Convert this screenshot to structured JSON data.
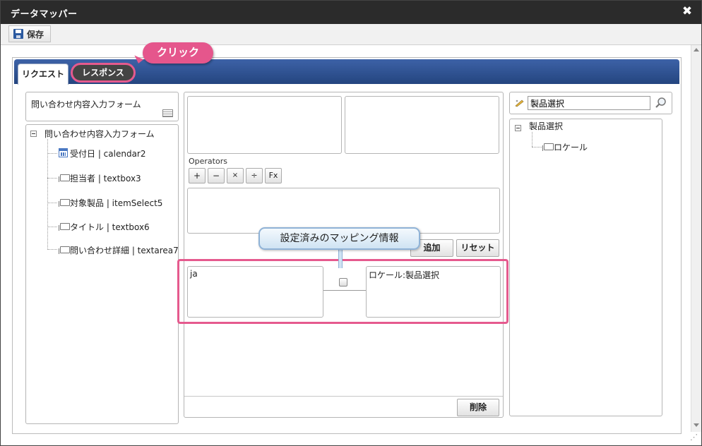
{
  "window": {
    "title": "データマッパー",
    "close_glyph": "✖"
  },
  "toolbar": {
    "save_label": "保存"
  },
  "tabs": [
    {
      "label": "リクエスト"
    },
    {
      "label": "レスポンス"
    }
  ],
  "annotations": {
    "click_label": "クリック",
    "mapping_info_label": "設定済みのマッピング情報",
    "highlight_color": "#e55a8e"
  },
  "left_panel": {
    "form_title": "問い合わせ内容入力フォーム",
    "tree_root": "問い合わせ内容入力フォーム",
    "items": [
      {
        "label": "受付日 | calendar2",
        "icon": "calendar-icon"
      },
      {
        "label": "担当者 | textbox3",
        "icon": "field-icon"
      },
      {
        "label": "対象製品 | itemSelect5",
        "icon": "field-icon"
      },
      {
        "label": "タイトル | textbox6",
        "icon": "field-icon"
      },
      {
        "label": "問い合わせ詳細 | textarea7",
        "icon": "field-icon"
      }
    ]
  },
  "center_panel": {
    "operators_label": "Operators",
    "operators": [
      "+",
      "−",
      "×",
      "÷",
      "Fx"
    ],
    "add_label": "追加",
    "reset_label": "リセット",
    "delete_label": "削除",
    "mapping": {
      "source": "ja",
      "target": "ロケール:製品選択"
    }
  },
  "right_panel": {
    "search_value": "製品選択",
    "tree_root": "製品選択",
    "items": [
      {
        "label": "ロケール",
        "icon": "field-icon"
      }
    ]
  },
  "colors": {
    "title_bar": "#2b2b2b",
    "tab_bar": "#2f548f",
    "accent_pink": "#e5568c"
  }
}
